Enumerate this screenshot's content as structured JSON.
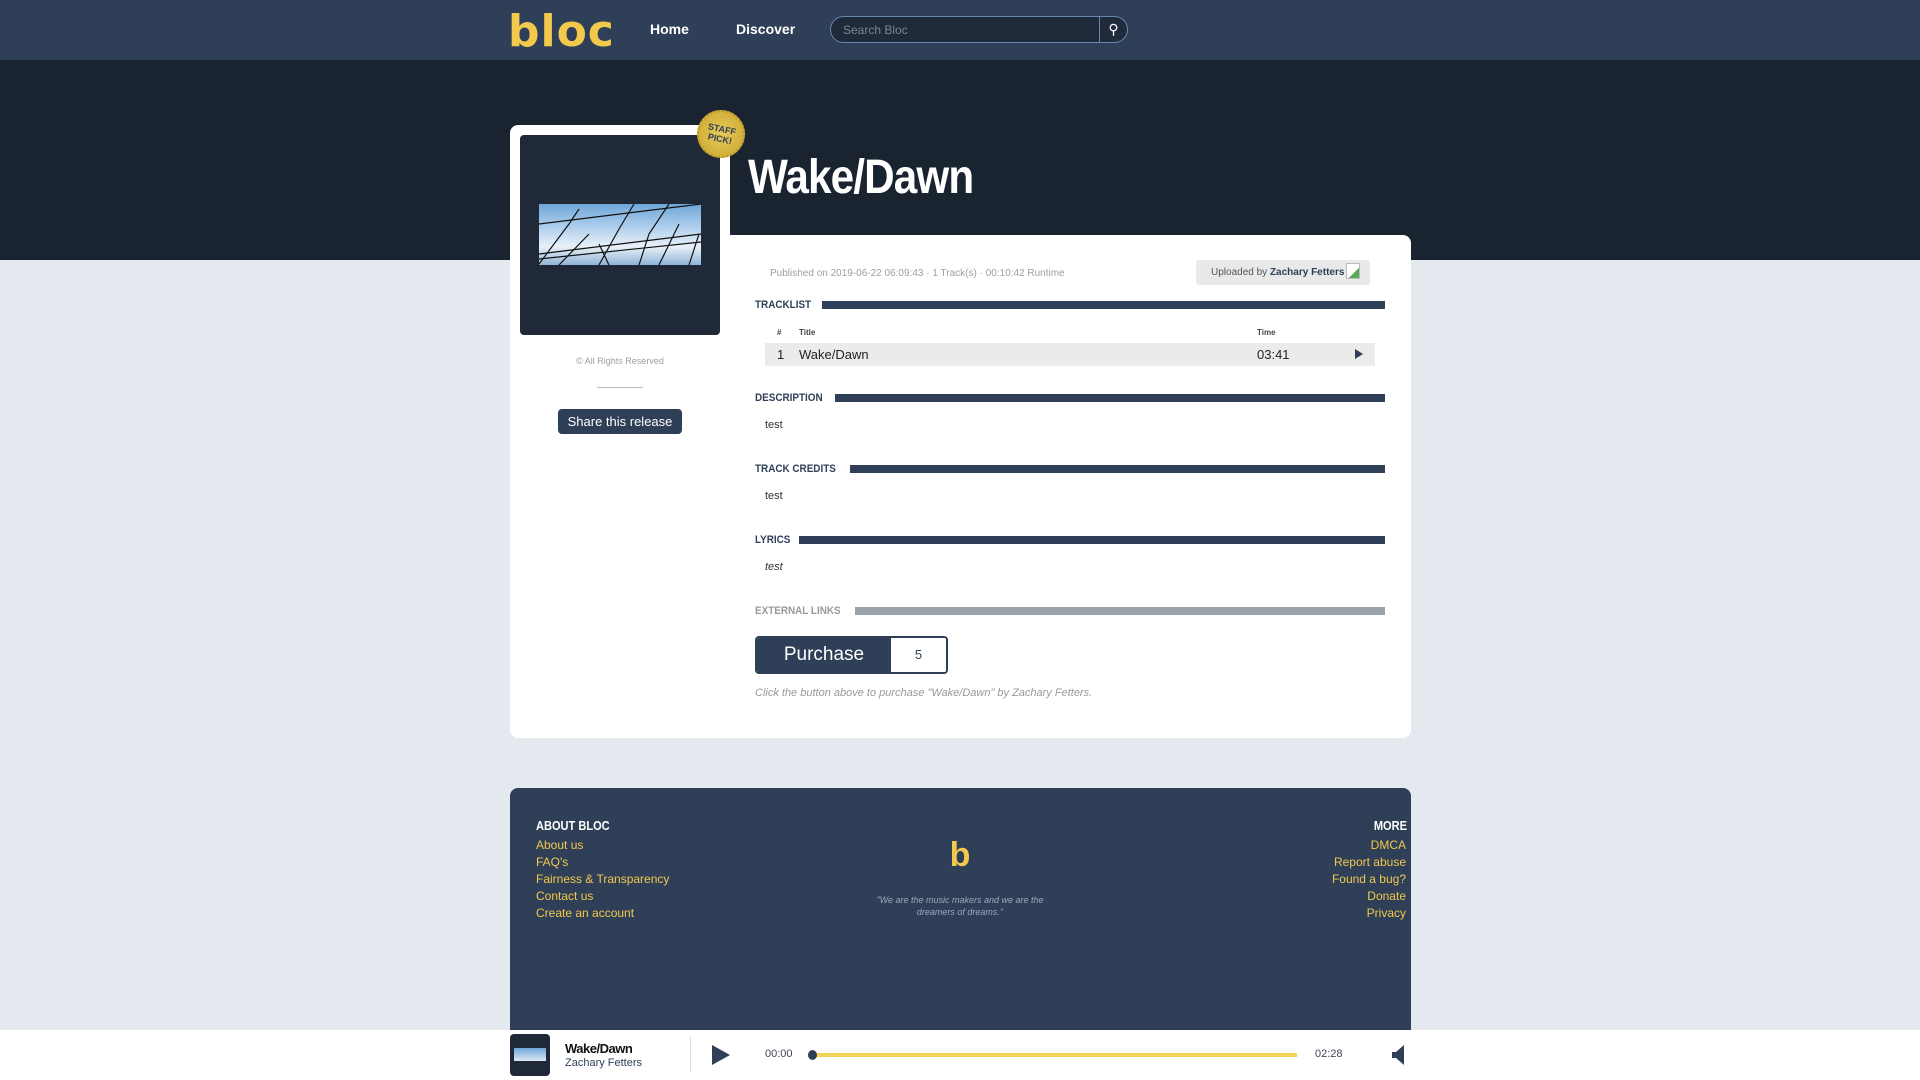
{
  "header": {
    "logo": "bloc",
    "nav": [
      "Home",
      "Discover"
    ],
    "search_placeholder": "Search Bloc"
  },
  "release": {
    "title": "Wake/Dawn",
    "badge": "STAFF PICK!",
    "rights": "© All Rights Reserved",
    "share_label": "Share this release",
    "published": "Published on 2019-06-22 06:09:43 · 1 Track(s) · 00:10:42 Runtime",
    "uploaded_by_label": "Uploaded by",
    "uploader": "Zachary Fetters"
  },
  "tracklist": {
    "heading": "TRACKLIST",
    "columns": [
      "#",
      "Title",
      "Time"
    ],
    "tracks": [
      {
        "num": "1",
        "title": "Wake/Dawn",
        "time": "03:41"
      }
    ]
  },
  "sections": {
    "description": {
      "heading": "DESCRIPTION",
      "text": "test"
    },
    "credits": {
      "heading": "TRACK CREDITS",
      "text": "test"
    },
    "lyrics": {
      "heading": "LYRICS",
      "text": "test"
    },
    "external": {
      "heading": "EXTERNAL LINKS"
    }
  },
  "purchase": {
    "label": "Purchase",
    "price": "5",
    "note": "Click the button above to purchase \"Wake/Dawn\" by Zachary Fetters."
  },
  "footer": {
    "about_heading": "ABOUT BLOC",
    "about_links": [
      "About us",
      "FAQ's",
      "Fairness & Transparency",
      "Contact us",
      "Create an account"
    ],
    "more_heading": "MORE",
    "more_links": [
      "DMCA",
      "Report abuse",
      "Found a bug?",
      "Donate",
      "Privacy"
    ],
    "logo": "b",
    "quote": "\"We are the music makers and we are the dreamers of dreams.\""
  },
  "player": {
    "title": "Wake/Dawn",
    "artist": "Zachary Fetters",
    "current": "00:00",
    "duration": "02:28",
    "progress": 0
  }
}
